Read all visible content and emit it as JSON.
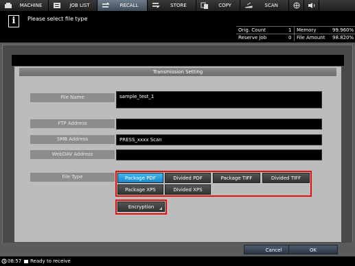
{
  "tabs": [
    {
      "label": "MACHINE",
      "icon": "machine-icon"
    },
    {
      "label": "JOB LIST",
      "icon": "job-list-icon"
    },
    {
      "label": "RECALL",
      "icon": "recall-icon"
    },
    {
      "label": "STORE",
      "icon": "store-icon"
    },
    {
      "label": "COPY",
      "icon": "copy-icon"
    },
    {
      "label": "SCAN",
      "icon": "scan-icon"
    }
  ],
  "message": "Please select file type",
  "counters": {
    "orig_count_label": "Orig. Count",
    "orig_count_value": "1",
    "memory_label": "Memory",
    "memory_value": "99.960%",
    "reserve_job_label": "Reserve Job",
    "reserve_job_value": "0",
    "file_amount_label": "File Amount",
    "file_amount_value": "98.820%"
  },
  "dialog": {
    "title": "Transmission Setting",
    "file_name_label": "File Name",
    "file_name_value": "sample_test_1",
    "ftp_label": "FTP Address",
    "ftp_value": "",
    "smb_label": "SMB Address",
    "smb_value": "PRESS_xxxx Scan",
    "webdav_label": "WebDAV Address",
    "webdav_value": "",
    "file_type_label": "File Type",
    "file_types": [
      "Package PDF",
      "Divided PDF",
      "Package TIFF",
      "Divided TIFF",
      "Package XPS",
      "Divided XPS"
    ],
    "selected_file_type": "Package PDF",
    "encryption_label": "Encryption",
    "cancel_label": "Cancel",
    "ok_label": "OK"
  },
  "status": {
    "time": "08:57",
    "text": "Ready to receive"
  },
  "colors": {
    "selected": "#2aa3e0",
    "highlight": "#e01010"
  }
}
